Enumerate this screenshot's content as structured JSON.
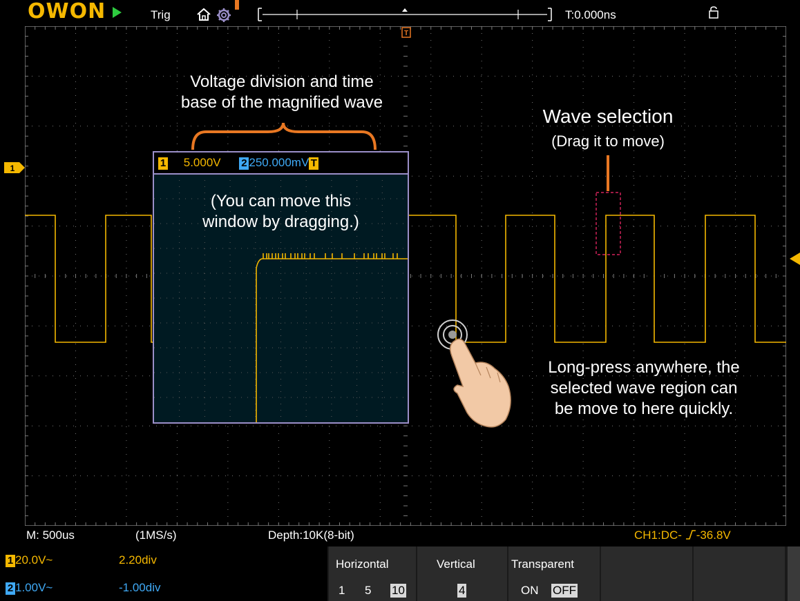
{
  "topbar": {
    "logo": "OWON",
    "trig_label": "Trig",
    "time_label": "T:0.000ns"
  },
  "colors": {
    "ch1": "#f5b800",
    "ch2": "#3fa9f5",
    "annotation": "#e87722",
    "grid": "#808080",
    "trigger_info": "#f5b800"
  },
  "icons": [
    "play-icon",
    "home-icon",
    "trigger-gear-icon",
    "lock-icon",
    "touch-hand-icon"
  ],
  "magnifier": {
    "ch1_badge": "1",
    "ch1_volt": "5.000V",
    "ch2_badge": "2",
    "ch2_volt": "250.000mV",
    "trig_badge": "T",
    "note_line1": "(You can move this",
    "note_line2": "window by dragging.)"
  },
  "annotations": {
    "volt_div_line1": "Voltage division and time",
    "volt_div_line2": "base of the magnified wave",
    "wave_sel_title": "Wave selection",
    "wave_sel_sub": "(Drag it to move)",
    "longpress_line1": "Long-press anywhere, the",
    "longpress_line2": "selected wave region can",
    "longpress_line3": "be move to here quickly."
  },
  "info_bar": {
    "timebase": "M: 500us",
    "sample_rate": "(1MS/s)",
    "depth": "Depth:10K(8-bit)",
    "trigger": "CH1:DC-",
    "trigger_level": "-36.8V"
  },
  "channels": [
    {
      "badge": "1",
      "volt": "20.0V~",
      "offset": "2.20div"
    },
    {
      "badge": "2",
      "volt": "1.00V~",
      "offset": "-1.00div"
    }
  ],
  "menu": {
    "horizontal": {
      "label": "Horizontal",
      "options": [
        "1",
        "5",
        "10"
      ],
      "selected": "10"
    },
    "vertical": {
      "label": "Vertical",
      "value": "4"
    },
    "transparent": {
      "label": "Transparent",
      "on": "ON",
      "off": "OFF",
      "selected": "OFF"
    }
  }
}
